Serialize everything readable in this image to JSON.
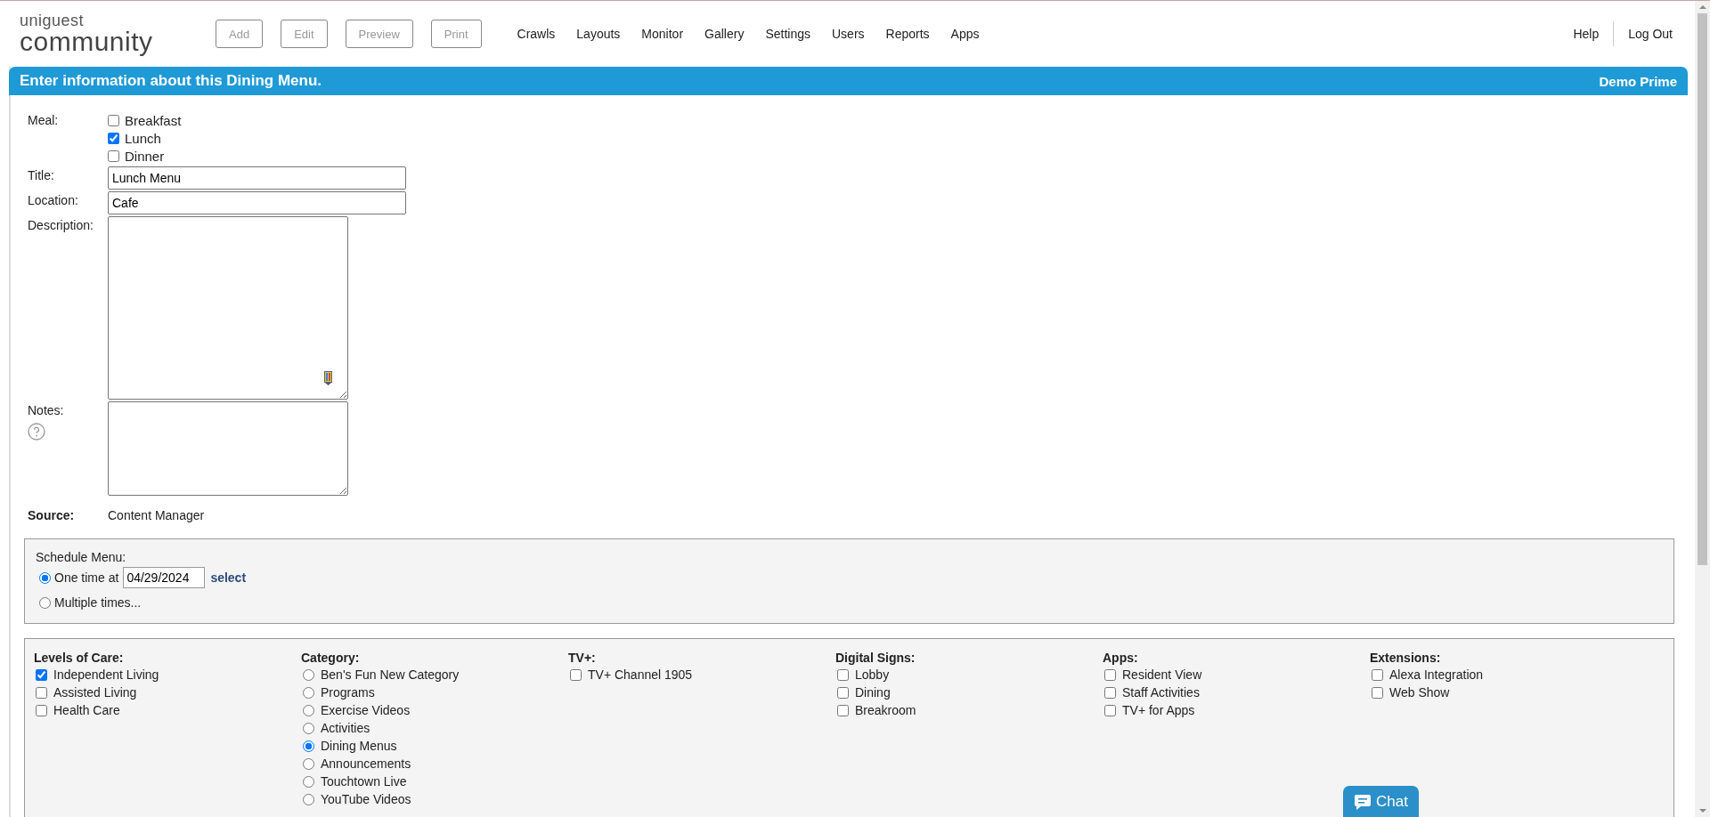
{
  "header": {
    "logo": {
      "top": "uniguest",
      "bottom": "community"
    },
    "buttons": [
      {
        "label": "Add",
        "disabled": true
      },
      {
        "label": "Edit",
        "disabled": true
      },
      {
        "label": "Preview",
        "disabled": true
      },
      {
        "label": "Print",
        "disabled": true
      }
    ],
    "nav": [
      "Crawls",
      "Layouts",
      "Monitor",
      "Gallery",
      "Settings",
      "Users",
      "Reports",
      "Apps"
    ],
    "right_links": [
      "Help",
      "Log Out"
    ]
  },
  "banner": {
    "title": "Enter information about this Dining Menu.",
    "account": "Demo Prime"
  },
  "meal": {
    "label": "Meal:",
    "options": [
      {
        "label": "Breakfast",
        "checked": false
      },
      {
        "label": "Lunch",
        "checked": true
      },
      {
        "label": "Dinner",
        "checked": false
      }
    ]
  },
  "fields": [
    {
      "kind": "input",
      "label": "Title:",
      "value": "Lunch Menu"
    },
    {
      "kind": "input",
      "label": "Location:",
      "value": "Cafe"
    },
    {
      "kind": "description",
      "label": "Description:"
    },
    {
      "kind": "notes",
      "label": "Notes:"
    }
  ],
  "source": {
    "label": "Source:",
    "value": "Content Manager"
  },
  "schedule": {
    "label": "Schedule Menu:",
    "options": [
      {
        "label": "One time at",
        "selected": true,
        "date": "04/29/2024",
        "link": "select"
      },
      {
        "label": "Multiple times...",
        "selected": false
      }
    ]
  },
  "groups": [
    {
      "title": "Levels of Care:",
      "kind": "checkbox",
      "items": [
        {
          "label": "Independent Living",
          "checked": true
        },
        {
          "label": "Assisted Living",
          "checked": false
        },
        {
          "label": "Health Care",
          "checked": false
        }
      ]
    },
    {
      "title": "Category:",
      "kind": "radio",
      "items": [
        {
          "label": "Ben's Fun New Category",
          "checked": false
        },
        {
          "label": "Programs",
          "checked": false
        },
        {
          "label": "Exercise Videos",
          "checked": false
        },
        {
          "label": "Activities",
          "checked": false
        },
        {
          "label": "Dining Menus",
          "checked": true
        },
        {
          "label": "Announcements",
          "checked": false
        },
        {
          "label": "Touchtown Live",
          "checked": false
        },
        {
          "label": "YouTube Videos",
          "checked": false
        }
      ]
    },
    {
      "title": "TV+:",
      "kind": "checkbox",
      "items": [
        {
          "label": "TV+ Channel 1905",
          "checked": false
        }
      ]
    },
    {
      "title": "Digital Signs:",
      "kind": "checkbox",
      "items": [
        {
          "label": "Lobby",
          "checked": false
        },
        {
          "label": "Dining",
          "checked": false
        },
        {
          "label": "Breakroom",
          "checked": false
        }
      ]
    },
    {
      "title": "Apps:",
      "kind": "checkbox",
      "items": [
        {
          "label": "Resident View",
          "checked": false
        },
        {
          "label": "Staff Activities",
          "checked": false
        },
        {
          "label": "TV+ for Apps",
          "checked": false
        }
      ]
    },
    {
      "title": "Extensions:",
      "kind": "checkbox",
      "items": [
        {
          "label": "Alexa Integration",
          "checked": false
        },
        {
          "label": "Web Show",
          "checked": false
        }
      ]
    }
  ],
  "chat": {
    "label": "Chat"
  }
}
